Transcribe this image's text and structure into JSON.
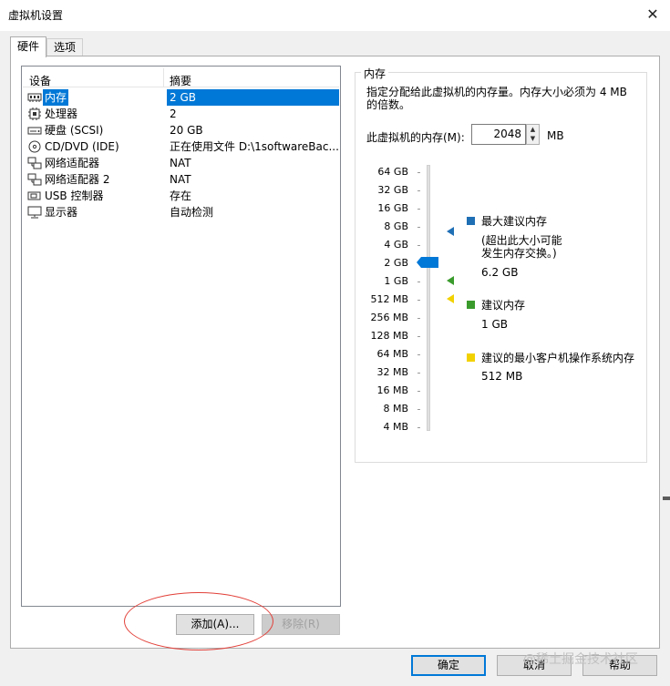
{
  "window": {
    "title": "虚拟机设置",
    "close": "✕"
  },
  "tabs": [
    {
      "label": "硬件"
    },
    {
      "label": "选项"
    }
  ],
  "device_list": {
    "headers": [
      "设备",
      "摘要"
    ],
    "rows": [
      {
        "icon": "memory-icon",
        "name": "内存",
        "summary": "2 GB"
      },
      {
        "icon": "processor-icon",
        "name": "处理器",
        "summary": "2"
      },
      {
        "icon": "hard-disk-icon",
        "name": "硬盘 (SCSI)",
        "summary": "20 GB"
      },
      {
        "icon": "cd-dvd-icon",
        "name": "CD/DVD (IDE)",
        "summary": "正在使用文件 D:\\1softwareBac..."
      },
      {
        "icon": "network-adapter-icon",
        "name": "网络适配器",
        "summary": "NAT"
      },
      {
        "icon": "network-adapter-icon",
        "name": "网络适配器 2",
        "summary": "NAT"
      },
      {
        "icon": "usb-icon",
        "name": "USB 控制器",
        "summary": "存在"
      },
      {
        "icon": "display-icon",
        "name": "显示器",
        "summary": "自动检测"
      }
    ],
    "selected_index": 0
  },
  "buttons": {
    "add": "添加(A)...",
    "remove": "移除(R)",
    "ok": "确定",
    "cancel": "取消",
    "help": "帮助"
  },
  "memory": {
    "group_title": "内存",
    "description": "指定分配给此虚拟机的内存量。内存大小必须为 4 MB 的倍数。",
    "field_label": "此虚拟机的内存(M):",
    "value": "2048",
    "unit": "MB",
    "scale_labels": [
      "64 GB",
      "32 GB",
      "16 GB",
      "8 GB",
      "4 GB",
      "2 GB",
      "1 GB",
      "512 MB",
      "256 MB",
      "128 MB",
      "64 MB",
      "32 MB",
      "16 MB",
      "8 MB",
      "4 MB"
    ],
    "slider_level": "2 GB",
    "legend": {
      "max": {
        "title": "最大建议内存",
        "note1": "(超出此大小可能",
        "note2": "发生内存交换。)",
        "value": "6.2 GB",
        "color": "#1f6fb5"
      },
      "recommended": {
        "title": "建议内存",
        "value": "1 GB",
        "color": "#3a9b2c"
      },
      "min_guest": {
        "title": "建议的最小客户机操作系统内存",
        "value": "512 MB",
        "color": "#f2d100"
      }
    }
  },
  "watermark": "@稀土掘金技术社区",
  "colors": {
    "selection": "#0078d7",
    "annotation_circle": "#e2413a"
  }
}
